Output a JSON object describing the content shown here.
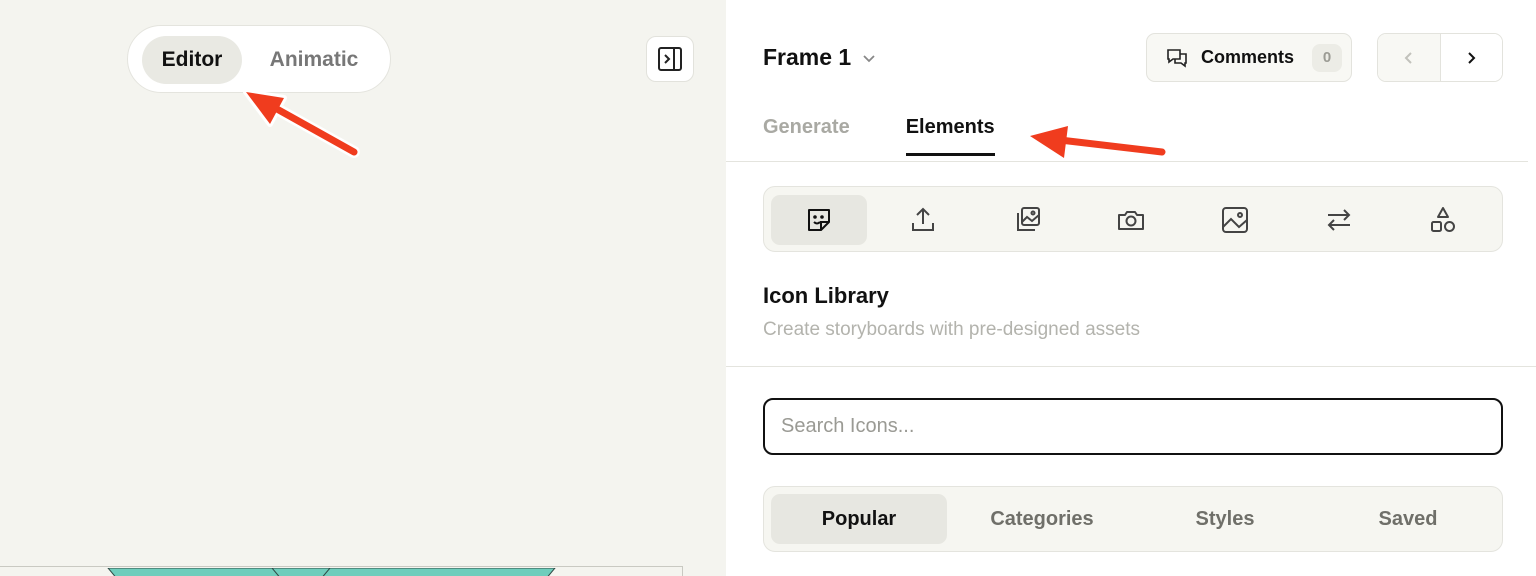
{
  "mode_switch": {
    "editor": "Editor",
    "animatic": "Animatic",
    "active": "Editor"
  },
  "header": {
    "frame_title": "Frame 1",
    "comments_label": "Comments",
    "comments_count": "0"
  },
  "tabs": [
    {
      "label": "Generate",
      "active": false
    },
    {
      "label": "Elements",
      "active": true
    }
  ],
  "toolbar": {
    "tools": [
      "sticker-icon",
      "upload-icon",
      "image-stack-icon",
      "camera-icon",
      "image-icon",
      "swap-arrows-icon",
      "shapes-icon"
    ],
    "active": "sticker-icon"
  },
  "library": {
    "title": "Icon Library",
    "subtitle": "Create storyboards with pre-designed assets"
  },
  "search": {
    "placeholder": "Search Icons...",
    "value": ""
  },
  "segments": {
    "items": [
      "Popular",
      "Categories",
      "Styles",
      "Saved"
    ],
    "active": "Popular"
  },
  "colors": {
    "annotation_arrow": "#f03c1e",
    "canvas_bg": "#f4f4ef",
    "preview_teal": "#6fcdbc"
  }
}
